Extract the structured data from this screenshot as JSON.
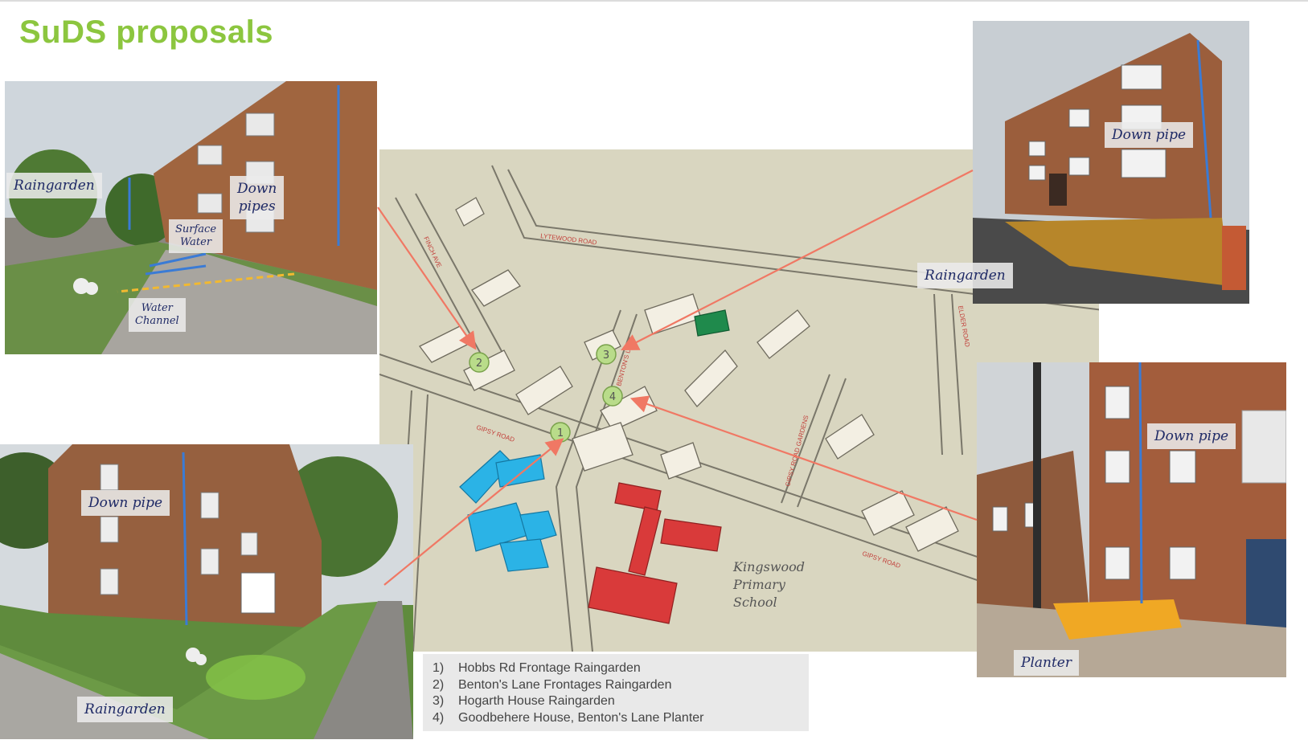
{
  "title": "SuDS proposals",
  "photo_labels": {
    "p1_raingarden": "Raingarden",
    "p1_down_pipes_1": "Down",
    "p1_down_pipes_2": "pipes",
    "p1_surface_1": "Surface",
    "p1_surface_2": "Water",
    "p1_channel_1": "Water",
    "p1_channel_2": "Channel",
    "p2_down_pipe": "Down pipe",
    "p2_raingarden": "Raingarden",
    "p3_down_pipe": "Down pipe",
    "p3_raingarden": "Raingarden",
    "p4_down_pipe": "Down pipe",
    "p4_planter": "Planter"
  },
  "map": {
    "markers": [
      "1",
      "2",
      "3",
      "4"
    ],
    "road_labels": {
      "gipsy_road_1": "GIPSY ROAD",
      "gipsy_road_2": "GIPSY ROAD",
      "bentons_lane": "BENTON'S LANE",
      "lytewood_road": "LYTEWOOD ROAD",
      "elder_road": "ELDER ROAD",
      "gipsy_road_gardens": "GIPSY ROAD GARDENS",
      "finch_ave": "FINCH AVE"
    },
    "school_1": "Kingswood",
    "school_2": "Primary",
    "school_3": "School"
  },
  "legend": [
    {
      "num": "1)",
      "text": "Hobbs Rd Frontage Raingarden"
    },
    {
      "num": "2)",
      "text": "Benton's Lane Frontages Raingarden"
    },
    {
      "num": "3)",
      "text": "Hogarth House Raingarden"
    },
    {
      "num": "4)",
      "text": "Goodbehere House, Benton's Lane Planter"
    }
  ],
  "colors": {
    "title": "#8cc63f",
    "connector": "#f07864",
    "down_pipe": "#3a7bd5",
    "school": "#d93a3a",
    "blue_building": "#2bb3e6",
    "green_building": "#1f8a4c",
    "marker": "#b9dc8a"
  }
}
